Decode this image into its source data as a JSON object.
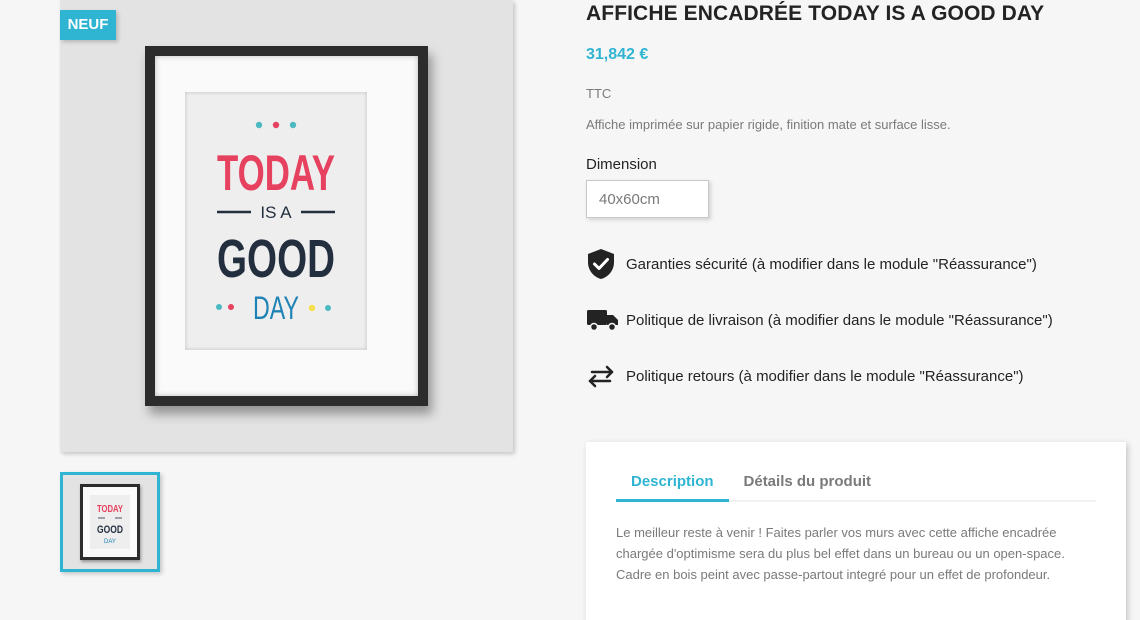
{
  "product": {
    "flag": "Neuf",
    "title": "Affiche encadrée today is a good day",
    "price": "31,842 €",
    "tax_label": "TTC",
    "short_description": "Affiche imprimée sur papier rigide, finition mate et surface lisse.",
    "variant_label": "Dimension",
    "variant_value": "40x60cm"
  },
  "artwork": {
    "line1": "TODAY",
    "line2": "IS A",
    "line3": "GOOD",
    "line4": "DAY"
  },
  "reassurance": [
    {
      "icon": "shield-check-icon",
      "label": "Garanties sécurité (à modifier dans le module \"Réassurance\")"
    },
    {
      "icon": "truck-icon",
      "label": "Politique de livraison (à modifier dans le module \"Réassurance\")"
    },
    {
      "icon": "swap-arrows-icon",
      "label": "Politique retours (à modifier dans le module \"Réassurance\")"
    }
  ],
  "tabs": [
    {
      "label": "Description",
      "active": true
    },
    {
      "label": "Détails du produit",
      "active": false
    }
  ],
  "description": "Le meilleur reste à venir ! Faites parler vos murs avec cette affiche encadrée chargée d'optimisme sera du plus bel effet dans un bureau ou un open-space. Cadre en bois peint avec passe-partout integré pour un effet de profondeur.",
  "colors": {
    "accent": "#2fb5d2",
    "text": "#232323",
    "muted": "#7a7a7a",
    "art_pink": "#e6415f",
    "art_navy": "#232f3e",
    "art_blue": "#1d82b5"
  }
}
